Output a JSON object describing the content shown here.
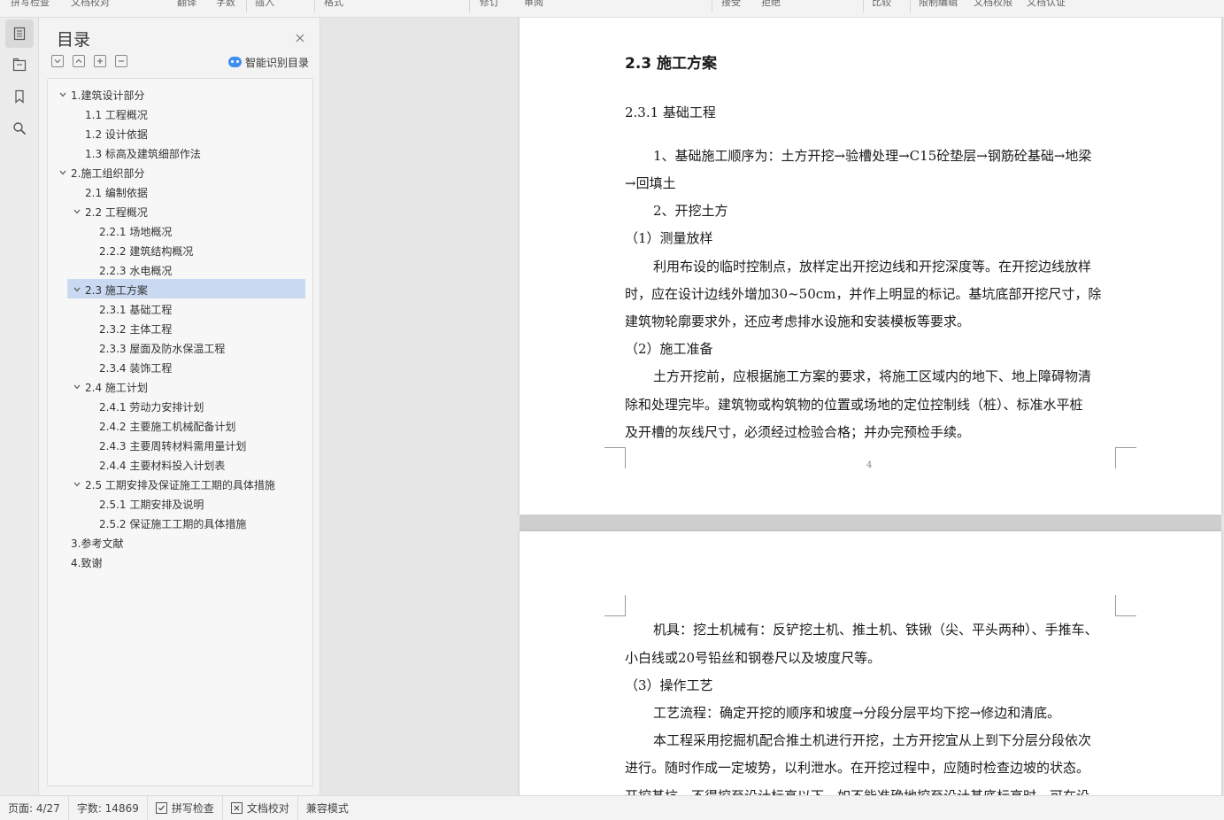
{
  "toolbar": {
    "items": [
      "拼写检查",
      "文档校对",
      "翻译",
      "字数",
      "插入",
      "格式",
      "修订",
      "审阅",
      "接受",
      "拒绝",
      "比较",
      "限制编辑",
      "文档权限",
      "文档认证"
    ]
  },
  "rail": {
    "icons": [
      "toc-icon",
      "nav-pane-icon",
      "bookmark-icon",
      "search-icon"
    ]
  },
  "toc": {
    "title": "目录",
    "smart_label": "智能识别目录",
    "items": [
      {
        "label": "1.建筑设计部分",
        "level": 1,
        "expanded": true,
        "has_children": true
      },
      {
        "label": "1.1 工程概况",
        "level": 2,
        "has_children": false
      },
      {
        "label": "1.2 设计依据",
        "level": 2,
        "has_children": false
      },
      {
        "label": "1.3 标高及建筑细部作法",
        "level": 2,
        "has_children": false
      },
      {
        "label": "2.施工组织部分",
        "level": 1,
        "expanded": true,
        "has_children": true
      },
      {
        "label": "2.1 编制依据",
        "level": 2,
        "has_children": false
      },
      {
        "label": "2.2 工程概况",
        "level": 2,
        "expanded": true,
        "has_children": true
      },
      {
        "label": "2.2.1 场地概况",
        "level": 3,
        "has_children": false
      },
      {
        "label": "2.2.2 建筑结构概况",
        "level": 3,
        "has_children": false
      },
      {
        "label": "2.2.3 水电概况",
        "level": 3,
        "has_children": false
      },
      {
        "label": "2.3 施工方案",
        "level": 2,
        "expanded": true,
        "has_children": true,
        "selected": true
      },
      {
        "label": "2.3.1 基础工程",
        "level": 3,
        "has_children": false
      },
      {
        "label": "2.3.2 主体工程",
        "level": 3,
        "has_children": false
      },
      {
        "label": "2.3.3 屋面及防水保温工程",
        "level": 3,
        "has_children": false
      },
      {
        "label": "2.3.4 装饰工程",
        "level": 3,
        "has_children": false
      },
      {
        "label": "2.4 施工计划",
        "level": 2,
        "expanded": true,
        "has_children": true
      },
      {
        "label": "2.4.1  劳动力安排计划",
        "level": 3,
        "has_children": false
      },
      {
        "label": "2.4.2  主要施工机械配备计划",
        "level": 3,
        "has_children": false
      },
      {
        "label": "2.4.3  主要周转材料需用量计划",
        "level": 3,
        "has_children": false
      },
      {
        "label": "2.4.4  主要材料投入计划表",
        "level": 3,
        "has_children": false
      },
      {
        "label": "2.5 工期安排及保证施工工期的具体措施",
        "level": 2,
        "expanded": true,
        "has_children": true
      },
      {
        "label": "2.5.1 工期安排及说明",
        "level": 3,
        "has_children": false
      },
      {
        "label": "2.5.2  保证施工工期的具体措施",
        "level": 3,
        "has_children": false
      },
      {
        "label": "3.参考文献",
        "level": 1,
        "has_children": false
      },
      {
        "label": "4.致谢",
        "level": 1,
        "has_children": false
      }
    ]
  },
  "document": {
    "page1": {
      "heading": "2.3 施工方案",
      "subheading": "2.3.1 基础工程",
      "lines": [
        "1、基础施工顺序为：土方开挖→验槽处理→C15砼垫层→钢筋砼基础→地梁",
        "→回填土",
        "2、开挖土方",
        "（1）测量放样",
        "利用布设的临时控制点，放样定出开挖边线和开挖深度等。在开挖边线放样",
        "时，应在设计边线外增加30~50cm，并作上明显的标记。基坑底部开挖尺寸，除",
        "建筑物轮廓要求外，还应考虑排水设施和安装模板等要求。",
        "（2）施工准备",
        "土方开挖前，应根据施工方案的要求，将施工区域内的地下、地上障碍物清",
        "除和处理完毕。建筑物或构筑物的位置或场地的定位控制线（桩）、标准水平桩",
        "及开槽的灰线尺寸，必须经过检验合格；并办完预检手续。"
      ],
      "page_number": "4"
    },
    "page2": {
      "lines": [
        "机具：挖土机械有：反铲挖土机、推土机、铁锹（尖、平头两种）、手推车、",
        "小白线或20号铅丝和钢卷尺以及坡度尺等。",
        "（3）操作工艺",
        "工艺流程：确定开挖的顺序和坡度→分段分层平均下挖→修边和清底。",
        "本工程采用挖掘机配合推土机进行开挖，土方开挖宜从上到下分层分段依次",
        "进行。随时作成一定坡势，以利泄水。在开挖过程中，应随时检查边坡的状态。",
        "开挖基坑，不得挖至设计标高以下，如不能准确地挖至设计基底标高时，可在设"
      ]
    }
  },
  "status": {
    "page": "页面: 4/27",
    "words": "字数: 14869",
    "spell": "拼写检查",
    "proof": "文档校对",
    "compat": "兼容模式"
  }
}
